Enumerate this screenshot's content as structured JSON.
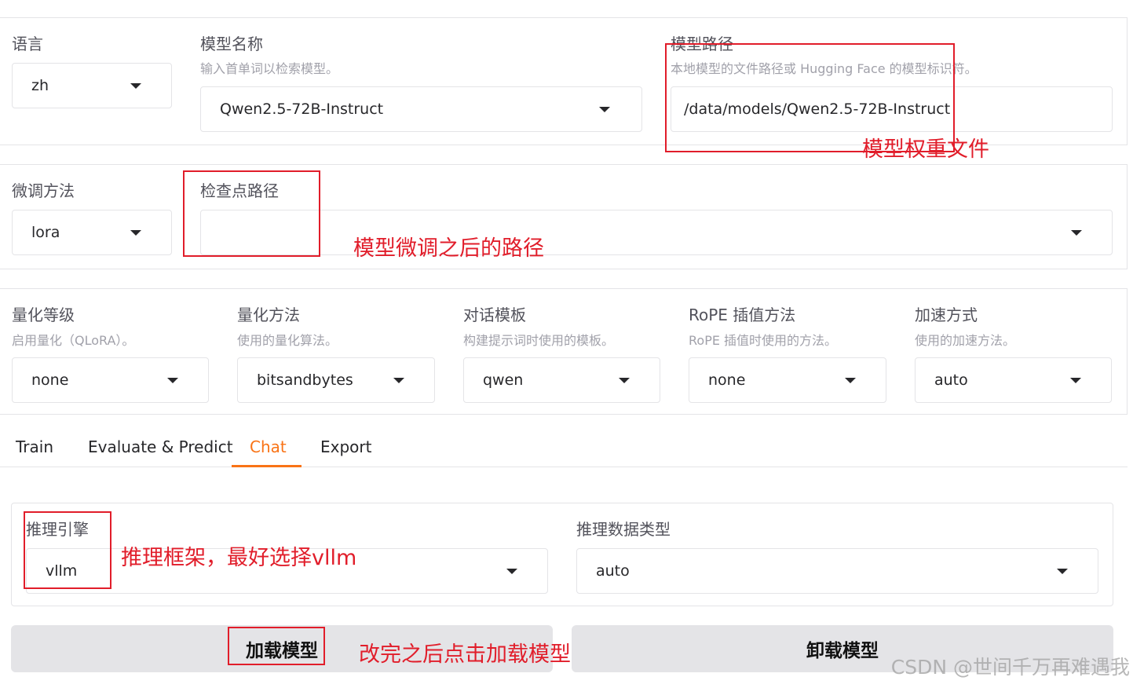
{
  "row1": {
    "lang": {
      "label": "语言",
      "value": "zh"
    },
    "model_name": {
      "label": "模型名称",
      "info": "输入首单词以检索模型。",
      "value": "Qwen2.5-72B-Instruct"
    },
    "model_path": {
      "label": "模型路径",
      "info": "本地模型的文件路径或 Hugging Face 的模型标识符。",
      "value": "/data/models/Qwen2.5-72B-Instruct"
    }
  },
  "row2": {
    "finetune": {
      "label": "微调方法",
      "value": "lora"
    },
    "checkpoint": {
      "label": "检查点路径",
      "value": ""
    }
  },
  "row3": {
    "quant_bit": {
      "label": "量化等级",
      "info": "启用量化（QLoRA）。",
      "value": "none"
    },
    "quant_method": {
      "label": "量化方法",
      "info": "使用的量化算法。",
      "value": "bitsandbytes"
    },
    "template": {
      "label": "对话模板",
      "info": "构建提示词时使用的模板。",
      "value": "qwen"
    },
    "rope": {
      "label": "RoPE 插值方法",
      "info": "RoPE 插值时使用的方法。",
      "value": "none"
    },
    "booster": {
      "label": "加速方式",
      "info": "使用的加速方法。",
      "value": "auto"
    }
  },
  "tabs": [
    {
      "label": "Train"
    },
    {
      "label": "Evaluate & Predict"
    },
    {
      "label": "Chat"
    },
    {
      "label": "Export"
    }
  ],
  "infer": {
    "backend": {
      "label": "推理引擎",
      "value": "vllm"
    },
    "dtype": {
      "label": "推理数据类型",
      "value": "auto"
    }
  },
  "buttons": {
    "load": "加载模型",
    "unload": "卸载模型"
  },
  "annotations": {
    "model_path": "模型权重文件",
    "checkpoint": "模型微调之后的路径",
    "backend": "推理框架，最好选择vllm",
    "load": "改完之后点击加载模型"
  },
  "watermark": "CSDN @世间千万再难遇我",
  "colors": {
    "accent": "#f97316",
    "annotation": "#e11d2a"
  }
}
